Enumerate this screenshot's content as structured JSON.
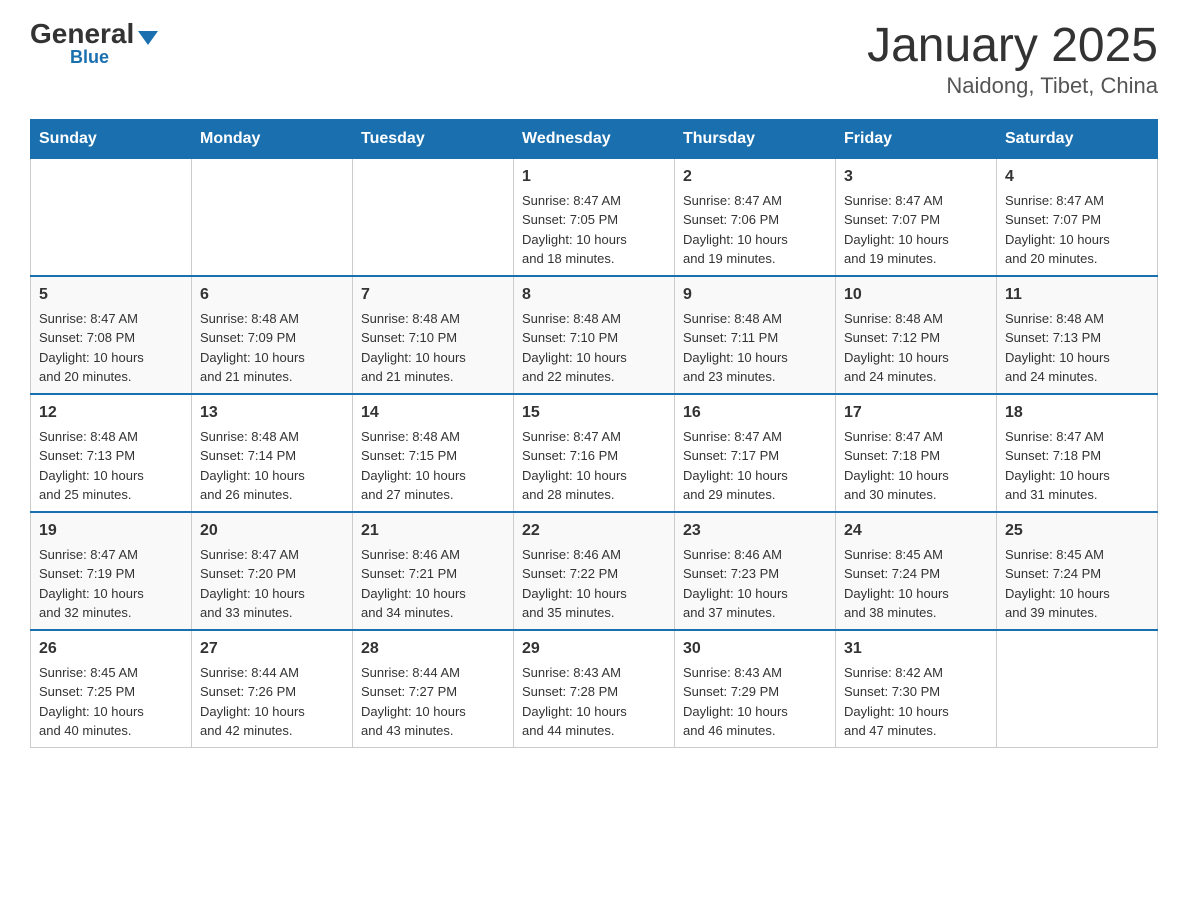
{
  "header": {
    "logo_general": "General",
    "logo_blue": "Blue",
    "month_title": "January 2025",
    "location": "Naidong, Tibet, China"
  },
  "weekdays": [
    "Sunday",
    "Monday",
    "Tuesday",
    "Wednesday",
    "Thursday",
    "Friday",
    "Saturday"
  ],
  "weeks": [
    [
      {
        "day": "",
        "info": ""
      },
      {
        "day": "",
        "info": ""
      },
      {
        "day": "",
        "info": ""
      },
      {
        "day": "1",
        "info": "Sunrise: 8:47 AM\nSunset: 7:05 PM\nDaylight: 10 hours\nand 18 minutes."
      },
      {
        "day": "2",
        "info": "Sunrise: 8:47 AM\nSunset: 7:06 PM\nDaylight: 10 hours\nand 19 minutes."
      },
      {
        "day": "3",
        "info": "Sunrise: 8:47 AM\nSunset: 7:07 PM\nDaylight: 10 hours\nand 19 minutes."
      },
      {
        "day": "4",
        "info": "Sunrise: 8:47 AM\nSunset: 7:07 PM\nDaylight: 10 hours\nand 20 minutes."
      }
    ],
    [
      {
        "day": "5",
        "info": "Sunrise: 8:47 AM\nSunset: 7:08 PM\nDaylight: 10 hours\nand 20 minutes."
      },
      {
        "day": "6",
        "info": "Sunrise: 8:48 AM\nSunset: 7:09 PM\nDaylight: 10 hours\nand 21 minutes."
      },
      {
        "day": "7",
        "info": "Sunrise: 8:48 AM\nSunset: 7:10 PM\nDaylight: 10 hours\nand 21 minutes."
      },
      {
        "day": "8",
        "info": "Sunrise: 8:48 AM\nSunset: 7:10 PM\nDaylight: 10 hours\nand 22 minutes."
      },
      {
        "day": "9",
        "info": "Sunrise: 8:48 AM\nSunset: 7:11 PM\nDaylight: 10 hours\nand 23 minutes."
      },
      {
        "day": "10",
        "info": "Sunrise: 8:48 AM\nSunset: 7:12 PM\nDaylight: 10 hours\nand 24 minutes."
      },
      {
        "day": "11",
        "info": "Sunrise: 8:48 AM\nSunset: 7:13 PM\nDaylight: 10 hours\nand 24 minutes."
      }
    ],
    [
      {
        "day": "12",
        "info": "Sunrise: 8:48 AM\nSunset: 7:13 PM\nDaylight: 10 hours\nand 25 minutes."
      },
      {
        "day": "13",
        "info": "Sunrise: 8:48 AM\nSunset: 7:14 PM\nDaylight: 10 hours\nand 26 minutes."
      },
      {
        "day": "14",
        "info": "Sunrise: 8:48 AM\nSunset: 7:15 PM\nDaylight: 10 hours\nand 27 minutes."
      },
      {
        "day": "15",
        "info": "Sunrise: 8:47 AM\nSunset: 7:16 PM\nDaylight: 10 hours\nand 28 minutes."
      },
      {
        "day": "16",
        "info": "Sunrise: 8:47 AM\nSunset: 7:17 PM\nDaylight: 10 hours\nand 29 minutes."
      },
      {
        "day": "17",
        "info": "Sunrise: 8:47 AM\nSunset: 7:18 PM\nDaylight: 10 hours\nand 30 minutes."
      },
      {
        "day": "18",
        "info": "Sunrise: 8:47 AM\nSunset: 7:18 PM\nDaylight: 10 hours\nand 31 minutes."
      }
    ],
    [
      {
        "day": "19",
        "info": "Sunrise: 8:47 AM\nSunset: 7:19 PM\nDaylight: 10 hours\nand 32 minutes."
      },
      {
        "day": "20",
        "info": "Sunrise: 8:47 AM\nSunset: 7:20 PM\nDaylight: 10 hours\nand 33 minutes."
      },
      {
        "day": "21",
        "info": "Sunrise: 8:46 AM\nSunset: 7:21 PM\nDaylight: 10 hours\nand 34 minutes."
      },
      {
        "day": "22",
        "info": "Sunrise: 8:46 AM\nSunset: 7:22 PM\nDaylight: 10 hours\nand 35 minutes."
      },
      {
        "day": "23",
        "info": "Sunrise: 8:46 AM\nSunset: 7:23 PM\nDaylight: 10 hours\nand 37 minutes."
      },
      {
        "day": "24",
        "info": "Sunrise: 8:45 AM\nSunset: 7:24 PM\nDaylight: 10 hours\nand 38 minutes."
      },
      {
        "day": "25",
        "info": "Sunrise: 8:45 AM\nSunset: 7:24 PM\nDaylight: 10 hours\nand 39 minutes."
      }
    ],
    [
      {
        "day": "26",
        "info": "Sunrise: 8:45 AM\nSunset: 7:25 PM\nDaylight: 10 hours\nand 40 minutes."
      },
      {
        "day": "27",
        "info": "Sunrise: 8:44 AM\nSunset: 7:26 PM\nDaylight: 10 hours\nand 42 minutes."
      },
      {
        "day": "28",
        "info": "Sunrise: 8:44 AM\nSunset: 7:27 PM\nDaylight: 10 hours\nand 43 minutes."
      },
      {
        "day": "29",
        "info": "Sunrise: 8:43 AM\nSunset: 7:28 PM\nDaylight: 10 hours\nand 44 minutes."
      },
      {
        "day": "30",
        "info": "Sunrise: 8:43 AM\nSunset: 7:29 PM\nDaylight: 10 hours\nand 46 minutes."
      },
      {
        "day": "31",
        "info": "Sunrise: 8:42 AM\nSunset: 7:30 PM\nDaylight: 10 hours\nand 47 minutes."
      },
      {
        "day": "",
        "info": ""
      }
    ]
  ]
}
